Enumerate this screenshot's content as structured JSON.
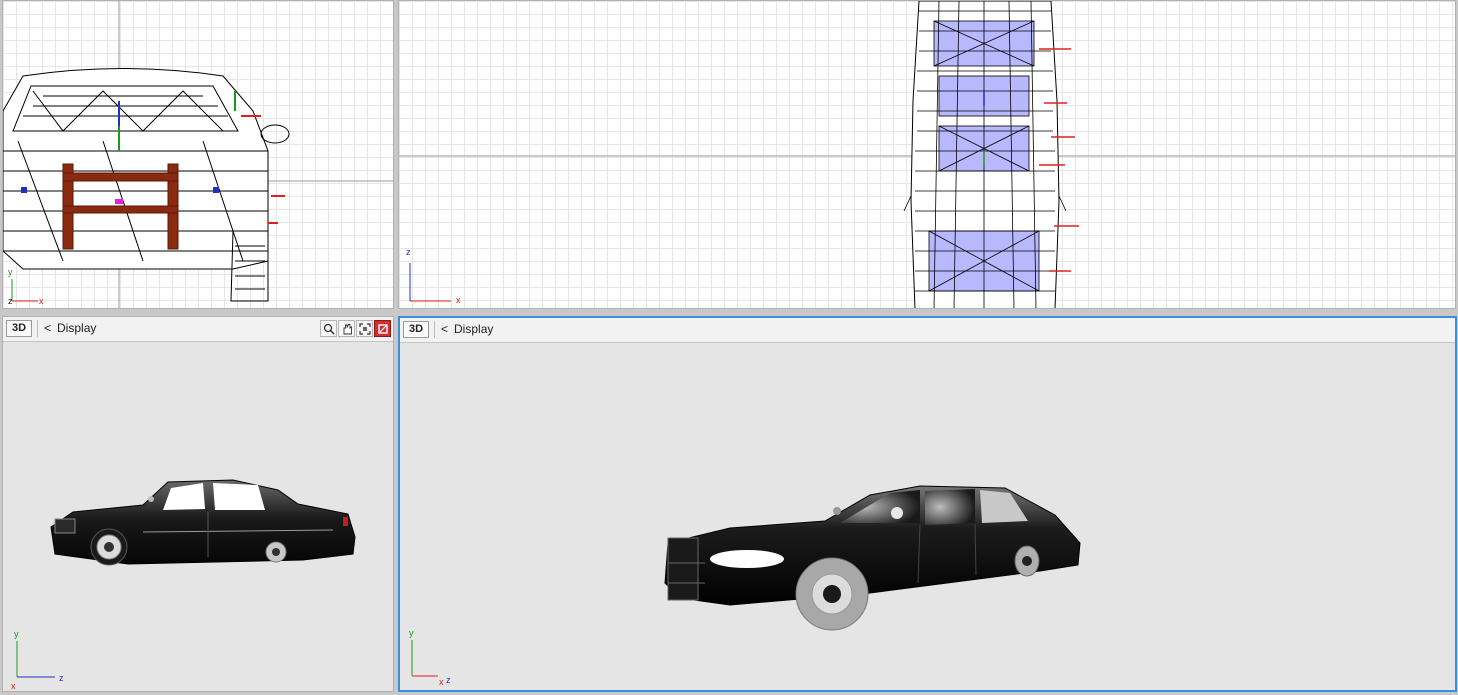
{
  "viewports": {
    "front": {
      "axis": {
        "v": "y",
        "depth": "z",
        "h": "x"
      }
    },
    "top": {
      "axis": {
        "v": "z",
        "h": "x"
      }
    },
    "side": {
      "badge": "3D",
      "menu_label": "Display",
      "axis": {
        "v": "y",
        "h": "z",
        "depth": "x"
      }
    },
    "persp": {
      "badge": "3D",
      "menu_label": "Display",
      "axis": {
        "v": "y",
        "h": "x",
        "depth": "z"
      }
    }
  },
  "icons": {
    "chevron": "chevron-left-icon",
    "zoom": "magnifier-icon",
    "pan": "hand-icon",
    "fit": "zoom-extents-icon",
    "maximize": "maximize-icon"
  },
  "colors": {
    "active_border": "#3a8ede",
    "axis_x": "#e02020",
    "axis_y": "#1a9a1a",
    "axis_z": "#2030c0",
    "wire": "#000000",
    "wire_fill": "#b8b8ff"
  }
}
